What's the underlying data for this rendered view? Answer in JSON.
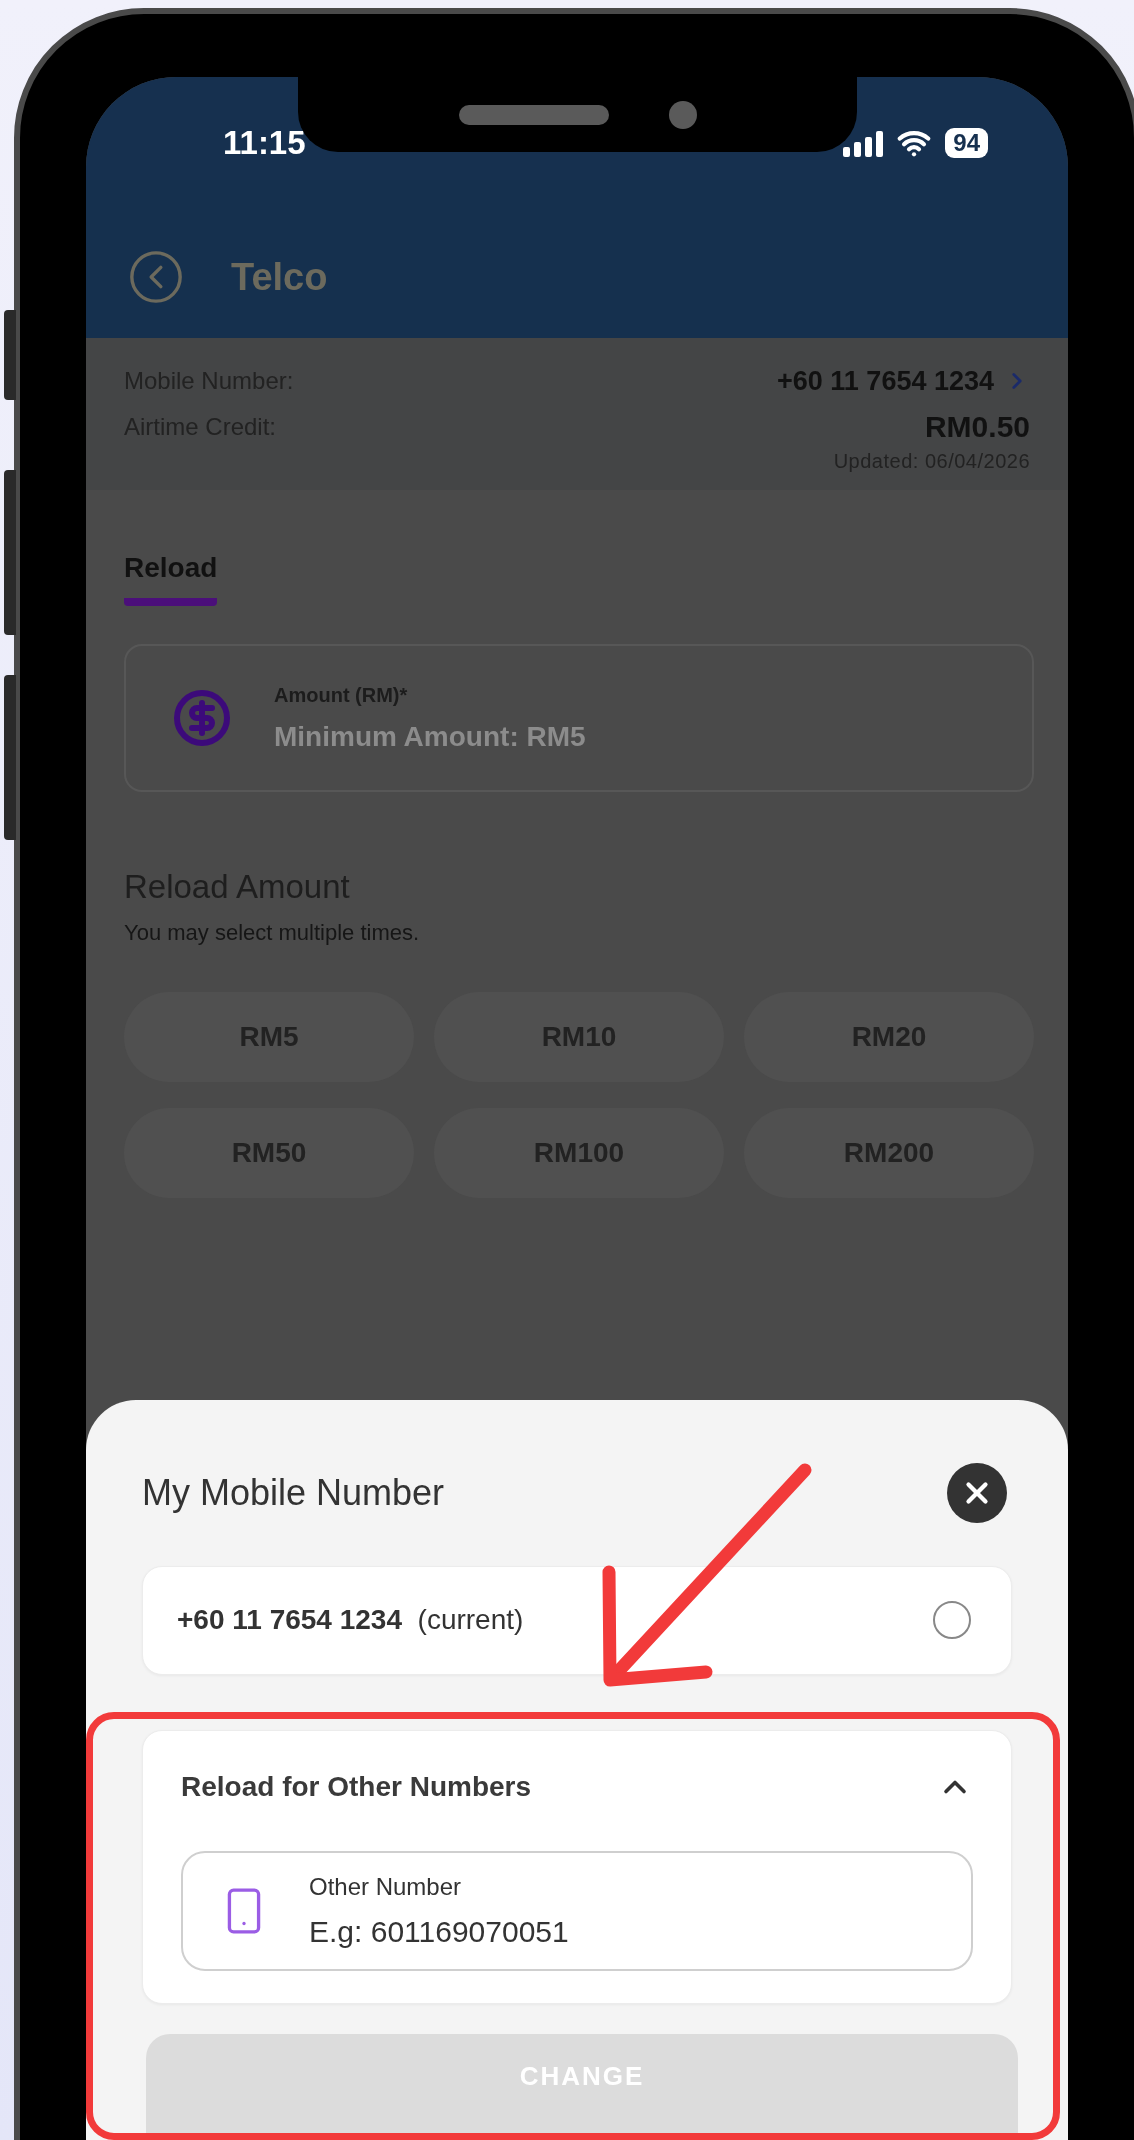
{
  "status_bar": {
    "time": "11:15",
    "battery": "94"
  },
  "header": {
    "title": "Telco"
  },
  "account": {
    "rows": [
      {
        "label": "Mobile Number:",
        "value": "+60 11 7654 1234",
        "kind": "link"
      },
      {
        "label": "Airtime Credit:",
        "value": "RM0.50",
        "kind": "plain"
      }
    ],
    "updated": "Updated: 06/04/2026"
  },
  "tabs": [
    {
      "label": "Reload",
      "selected": true
    }
  ],
  "amount_field": {
    "label": "Amount (RM)*",
    "placeholder": "Minimum Amount: RM5"
  },
  "reload_amount": {
    "title": "Reload Amount",
    "subtitle": "You may select multiple times.",
    "options": [
      {
        "label": "RM5",
        "selected": false
      },
      {
        "label": "RM10",
        "selected": false
      },
      {
        "label": "RM20",
        "selected": false
      },
      {
        "label": "RM50",
        "selected": false
      },
      {
        "label": "RM100",
        "selected": false
      },
      {
        "label": "RM200",
        "selected": false
      }
    ]
  },
  "sheet": {
    "title": "My Mobile Number",
    "current": {
      "number": "+60 11 7654 1234",
      "tag": "(current)",
      "selected": false
    },
    "other": {
      "title": "Reload for Other Numbers",
      "expanded": true,
      "field": {
        "label": "Other Number",
        "placeholder": "E.g: 601169070051"
      }
    },
    "button": {
      "label": "CHANGE",
      "disabled": true
    }
  }
}
